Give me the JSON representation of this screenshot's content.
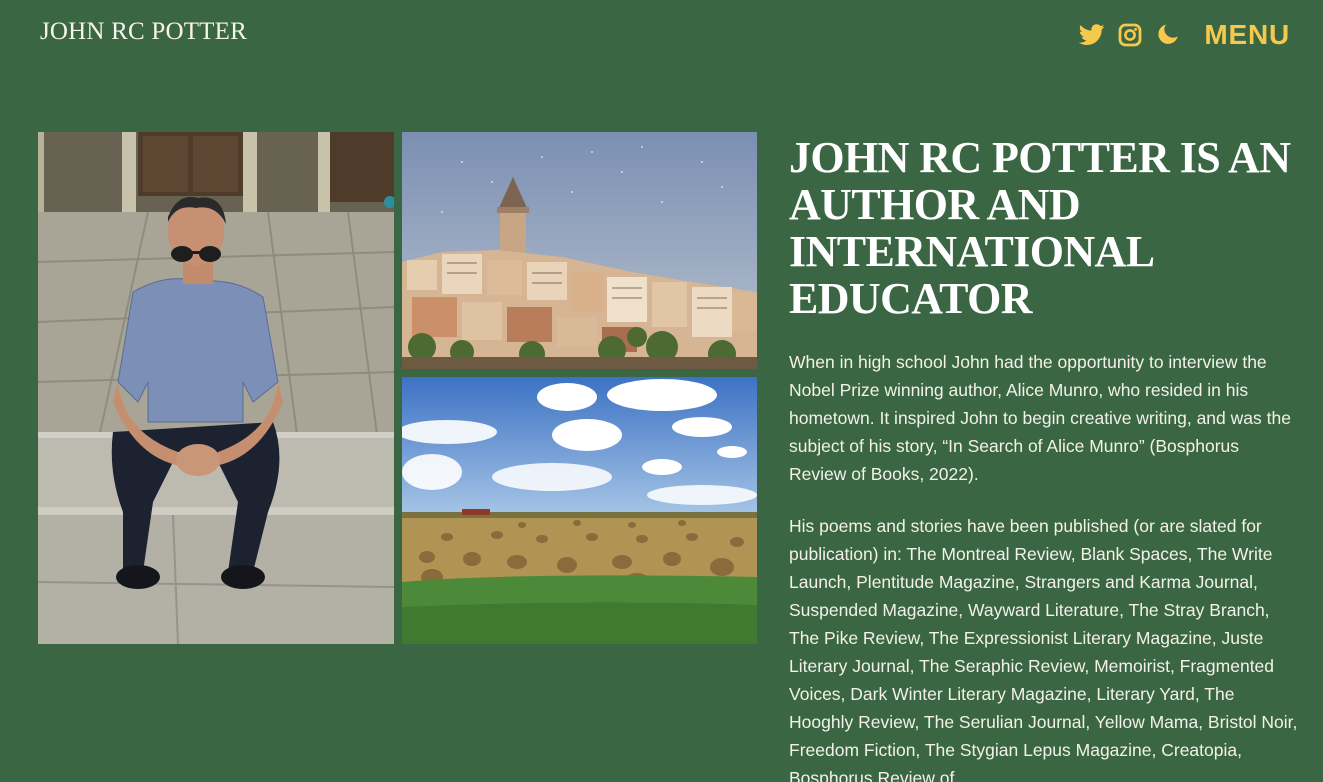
{
  "header": {
    "site_title": "JOHN RC POTTER",
    "icons": [
      "twitter-icon",
      "instagram-icon",
      "moon-icon"
    ],
    "menu_label": "MENU",
    "accent_color": "#f6c84b"
  },
  "colors": {
    "background": "#3a6643",
    "text": "#f3f1e8",
    "accent": "#f6c84b"
  },
  "main": {
    "headline": "JOHN RC POTTER IS AN AUTHOR AND INTERNATIONAL EDUCATOR",
    "paragraphs": [
      "When in high school John had the opportunity to interview the Nobel Prize winning author, Alice Munro, who resided in his hometown. It inspired John to begin creative writing, and was the subject of his story, “In Search of Alice Munro” (Bosphorus Review of Books, 2022).",
      "His poems and stories have been published (or are slated for publication) in: The Montreal Review, Blank Spaces, The Write Launch, Plentitude Magazine, Strangers and Karma Journal, Suspended Magazine, Wayward Literature, The Stray Branch, The Pike Review, The Expressionist Literary Magazine, Juste Literary Journal, The Seraphic Review, Memoirist, Fragmented Voices, Dark Winter Literary Magazine, Literary Yard, The Hooghly Review, The Serulian Journal, Yellow Mama, Bristol Noir, Freedom Fiction, The Stygian Lepus Magazine, Creatopia, Bosphorus Review of"
    ]
  }
}
